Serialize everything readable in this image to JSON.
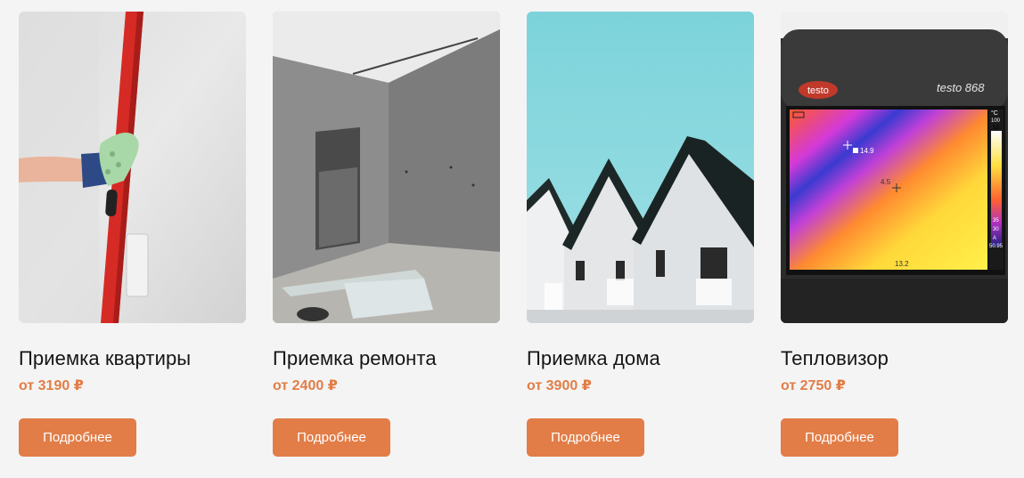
{
  "cards": [
    {
      "title": "Приемка квартиры",
      "price": "от 3190 ₽",
      "button": "Подробнее",
      "image": "level-on-wall-photo"
    },
    {
      "title": "Приемка ремонта",
      "price": "от 2400 ₽",
      "button": "Подробнее",
      "image": "concrete-room-photo"
    },
    {
      "title": "Приемка дома",
      "price": "от 3900 ₽",
      "button": "Подробнее",
      "image": "houses-gables-photo"
    },
    {
      "title": "Тепловизор",
      "price": "от 2750 ₽",
      "button": "Подробнее",
      "image": "thermal-camera-photo"
    }
  ],
  "thermal": {
    "brand": "testo",
    "model": "testo 868",
    "unit": "°C",
    "scale_top": "100",
    "scale_hi": "13",
    "scale_lo1": "35",
    "scale_lo2": "30",
    "scale_a": "A",
    "scale_num": "50.95",
    "spot1": "14.9",
    "spot2": "4.5",
    "bottom_value": "13.2"
  },
  "colors": {
    "accent": "#e27d47",
    "background": "#f4f4f4",
    "title": "#151515"
  }
}
